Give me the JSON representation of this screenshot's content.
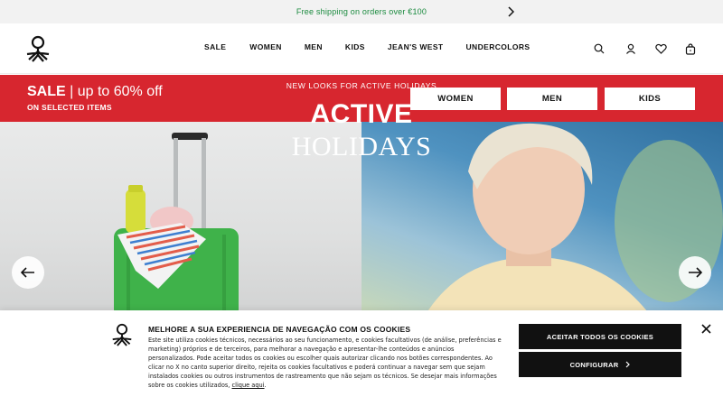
{
  "promo": {
    "text": "Free shipping on orders over €100",
    "next_icon": "chevron-right-icon"
  },
  "header": {
    "logo_icon": "benetton-logo-icon",
    "nav": [
      "SALE",
      "WOMEN",
      "MEN",
      "KIDS",
      "JEAN'S WEST",
      "UNDERCOLORS"
    ],
    "icons": [
      "search-icon",
      "user-icon",
      "heart-icon",
      "bag-icon"
    ]
  },
  "sale": {
    "title_bold": "SALE",
    "title_rest": " | up to 60% off",
    "subtitle": "ON SELECTED ITEMS",
    "buttons": [
      "WOMEN",
      "MEN",
      "KIDS"
    ],
    "color": "#d7262f"
  },
  "hero": {
    "kicker": "NEW LOOKS FOR ACTIVE HOLIDAYS",
    "title": "ACTIVE",
    "title2": "HOLIDAYS",
    "prev_icon": "arrow-left-icon",
    "next_icon": "arrow-right-icon"
  },
  "cookie": {
    "title": "MELHORE A SUA EXPERIENCIA DE NAVEGAÇÃO COM OS COOKIES",
    "body": "Este site utiliza cookies técnicos, necessários ao seu funcionamento, e cookies facultativos (de análise, preferências e marketing) próprios e de terceiros, para melhorar a navegação e apresentar-lhe conteúdos e anúncios personalizados. Pode aceitar todos os cookies ou escolher quais autorizar clicando nos botões correspondentes. Ao clicar no X no canto superior direito, rejeita os cookies facultativos e poderá continuar a navegar sem que sejam instalados cookies ou outros instrumentos de rastreamento que não sejam os técnicos. Se desejar mais informações sobre os cookies utilizados, ",
    "link": "clique aqui",
    "body_end": ".",
    "accept": "ACEITAR TODOS OS COOKIES",
    "configure": "CONFIGURAR",
    "close_icon": "close-icon"
  }
}
